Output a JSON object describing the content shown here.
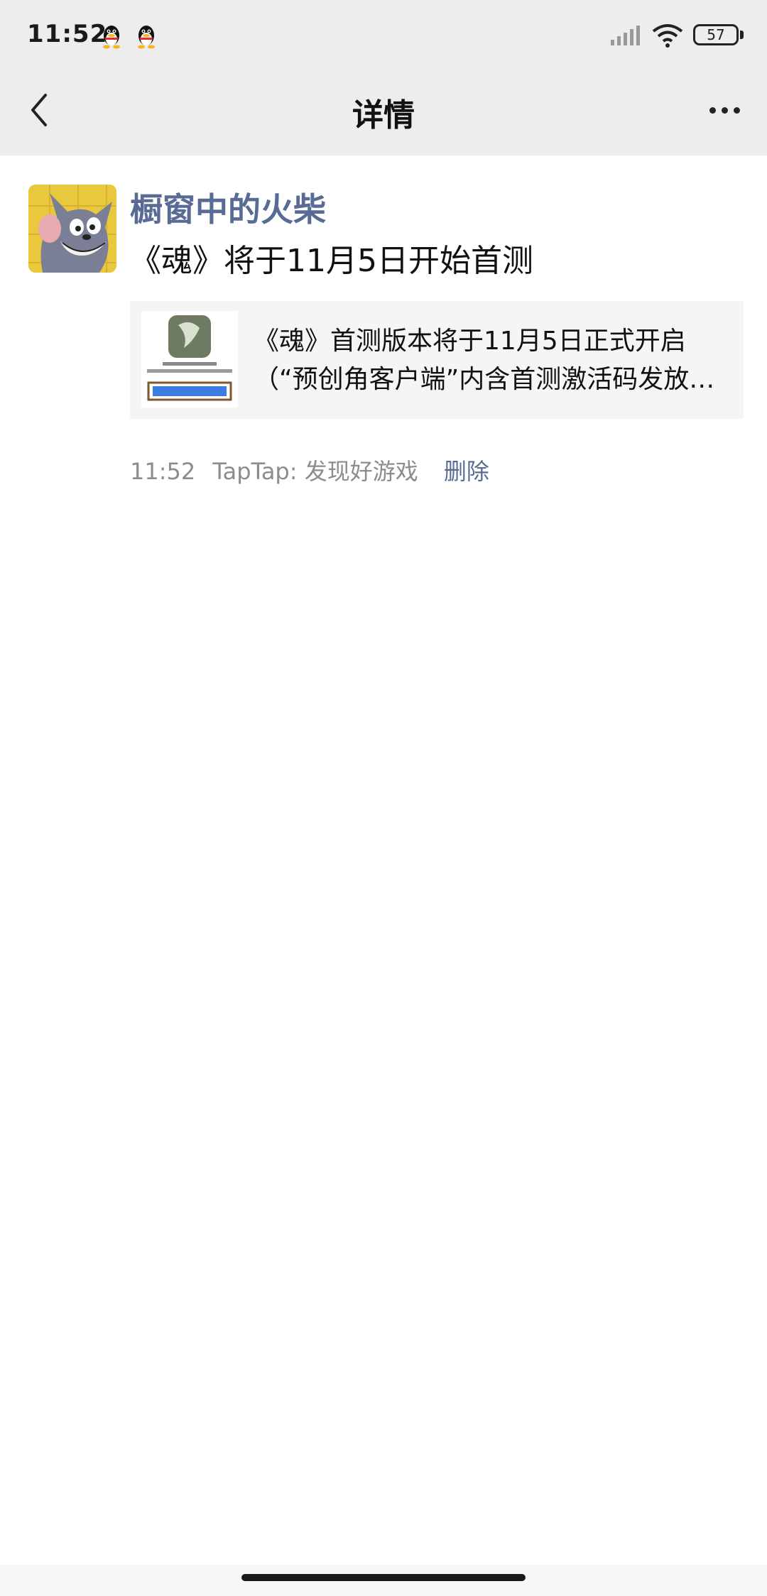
{
  "status_bar": {
    "time": "11:52",
    "battery": "57",
    "icons": [
      "qq-icon",
      "qq-icon",
      "signal-icon",
      "wifi-icon",
      "battery-icon"
    ]
  },
  "nav": {
    "title": "详情",
    "back_icon": "back-arrow-icon",
    "more_icon": "more-dots-icon"
  },
  "post": {
    "author": "橱窗中的火柴",
    "text": "《魂》将于11月5日开始首测",
    "link_card": {
      "title_line1": "《魂》首测版本将于11月5日正式开启",
      "title_line2": "（“预创角客户端”内含首测激活码发放…"
    },
    "meta": {
      "time": "11:52",
      "source": "TapTap: 发现好游戏",
      "delete_label": "删除"
    }
  },
  "colors": {
    "topbar_bg": "#ededed",
    "link_blue": "#576b95",
    "meta_gray": "#8c8c8c",
    "card_bg": "#f5f5f5"
  }
}
